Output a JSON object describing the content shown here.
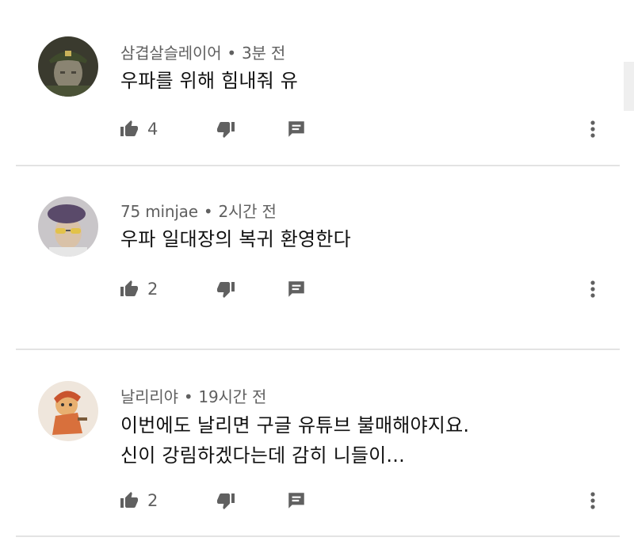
{
  "comments": [
    {
      "author": "삼겹살슬레이어",
      "time": "3분 전",
      "lines": [
        "우파를 위해 힘내줘  유"
      ],
      "likes": "4",
      "avatar_icon": "avatar-soldier-cap",
      "avatar_colors": {
        "bg": "#3a3a2e",
        "cap": "#3f4a2c",
        "face": "#8a8472"
      }
    },
    {
      "author": "75 minjae",
      "time": "2시간 전",
      "lines": [
        "우파 일대장의 복귀 환영한다"
      ],
      "likes": "2",
      "avatar_icon": "avatar-beret-sunglasses",
      "avatar_colors": {
        "bg": "#c9c6c9",
        "cap": "#5a4a6a",
        "face": "#d9c2a8"
      }
    },
    {
      "author": "날리리야",
      "time": "19시간 전",
      "lines": [
        "이번에도 날리면 구글 유튜브 불매해야지요.",
        "신이 강림하겠다는데 감히 니들이..."
      ],
      "likes": "2",
      "avatar_icon": "avatar-cartoon-character",
      "avatar_colors": {
        "bg": "#efe6dc",
        "cap": "#c9542e",
        "face": "#e8b070"
      }
    }
  ],
  "separator": "•",
  "icons": {
    "like": "thumbs-up-icon",
    "dislike": "thumbs-down-icon",
    "reply": "reply-comment-icon",
    "more": "more-vertical-icon"
  },
  "colors": {
    "icon": "#606060",
    "meta": "#606060",
    "text": "#111111",
    "divider": "#e3e3e3"
  }
}
